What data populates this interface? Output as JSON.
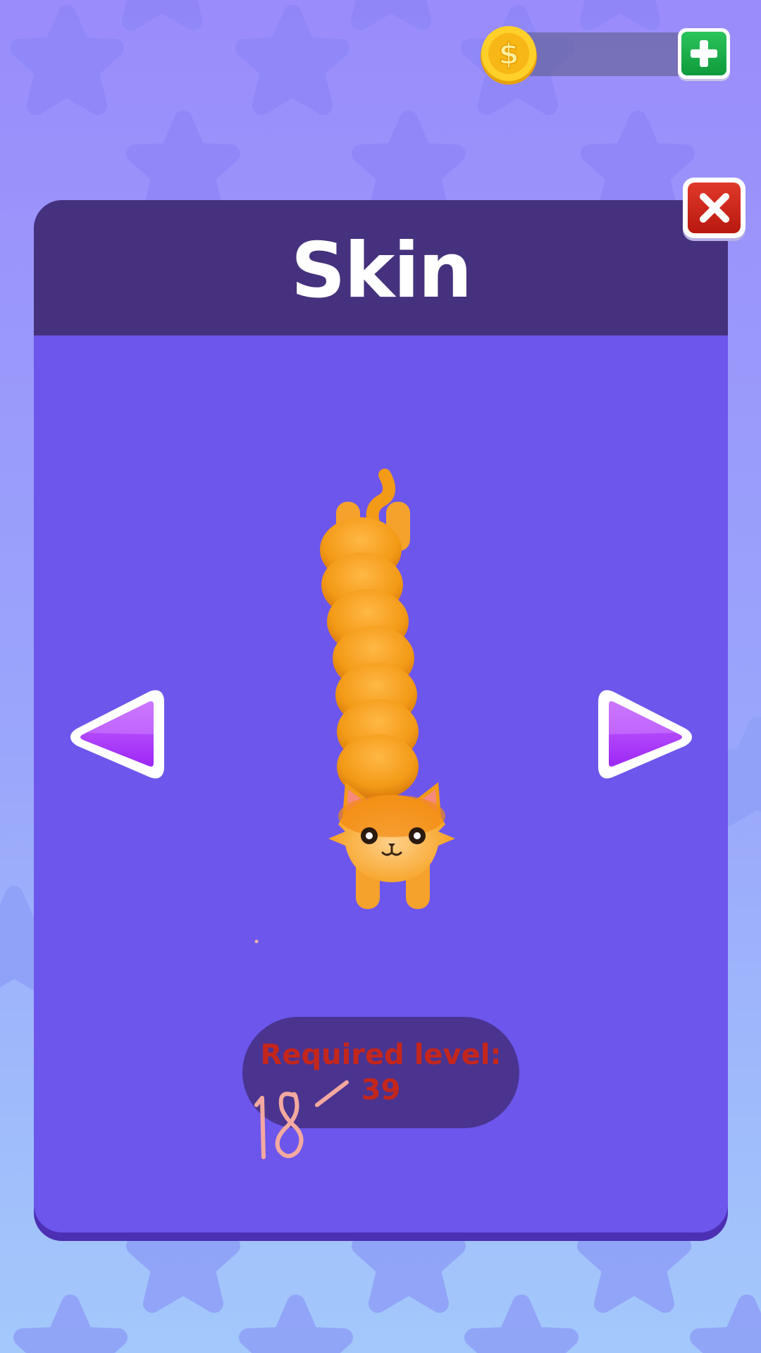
{
  "currency": {
    "coin_amount": "",
    "coin_icon": "dollar-coin-icon",
    "add_icon": "plus-icon"
  },
  "panel": {
    "title": "Skin",
    "close_icon": "close-x-icon"
  },
  "skin_viewer": {
    "prev_icon": "triangle-left-icon",
    "next_icon": "triangle-right-icon",
    "skin_name": "orange-tabby-cat"
  },
  "requirement": {
    "label": "Required level:",
    "value": "39"
  },
  "overlay": {
    "handwriting": "18´"
  },
  "colors": {
    "panel": "#6c56ec",
    "header": "#45317d",
    "requirement_text": "#c4261c",
    "add_button": "#17a947",
    "close_button": "#c9221a"
  }
}
